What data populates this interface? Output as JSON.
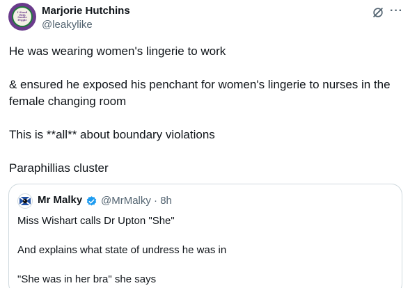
{
  "tweet": {
    "author": {
      "name": "Marjorie Hutchins",
      "handle": "@leakylike",
      "avatar_text": [
        "I Stand",
        "With",
        "Sandie",
        "Peggie"
      ]
    },
    "paragraphs": [
      "He was wearing women's lingerie to work",
      "& ensured he exposed his penchant for women's lingerie to nurses in the female changing room",
      "This is **all** about boundary violations",
      "Paraphillias cluster"
    ],
    "icons": {
      "grok": "grok-icon",
      "more": "more-icon"
    },
    "more_glyph": "···"
  },
  "quote": {
    "author": {
      "name": "Mr Malky",
      "handle_time": "@MrMalky · 8h",
      "verified": true,
      "verified_color": "#1d9bf0"
    },
    "paragraphs": [
      "Miss Wishart calls Dr Upton \"She\"",
      "And explains what state of undress he was in",
      "\"She was in her bra\" she says"
    ]
  },
  "colors": {
    "text": "#0f1419",
    "secondary": "#536471",
    "border": "#cfd9de"
  }
}
